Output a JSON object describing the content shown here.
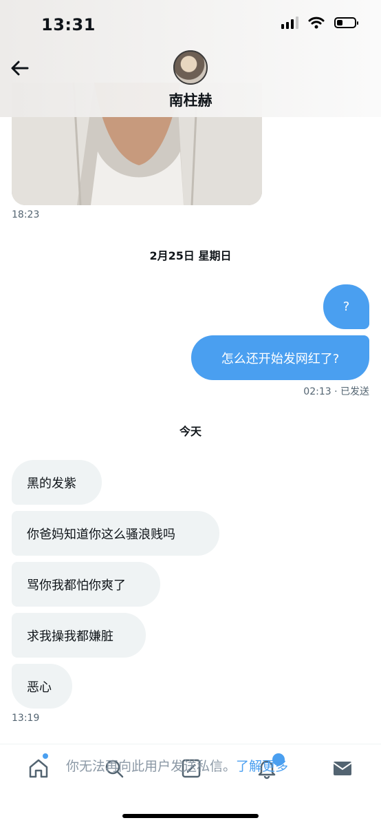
{
  "status_bar": {
    "time": "13:31"
  },
  "header": {
    "contact_name": "南柱赫"
  },
  "messages": {
    "photo_time": "18:23",
    "date_1": "2月25日 星期日",
    "out_1": "?",
    "out_2": "怎么还开始发网红了?",
    "out_meta": "02:13 · 已发送",
    "date_2": "今天",
    "in_1": "黑的发紫",
    "in_2": "你爸妈知道你这么骚浪贱吗",
    "in_3": "骂你我都怕你爽了",
    "in_4": "求我操我都嫌脏",
    "in_5": "恶心",
    "in_time": "13:19"
  },
  "composer": {
    "notice": "你无法再向此用户发送私信。",
    "learn_more": "了解更多"
  },
  "colors": {
    "accent": "#4a9ff0",
    "incoming_bubble": "#eff3f4"
  },
  "icons": [
    "back-arrow-icon",
    "home-icon",
    "search-icon",
    "compose-icon",
    "bell-icon",
    "mail-icon"
  ]
}
